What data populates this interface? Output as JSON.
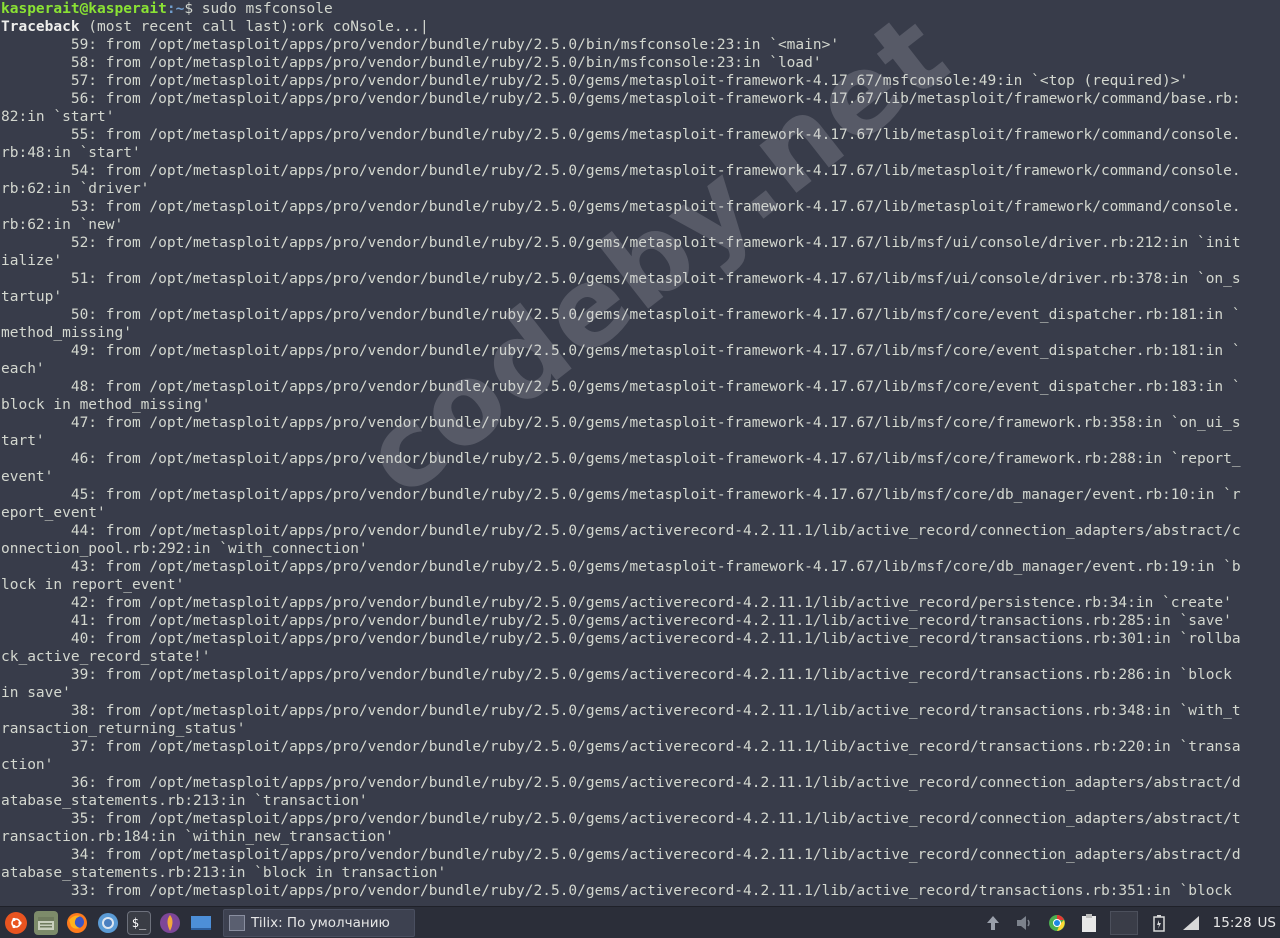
{
  "terminal": {
    "prompt_user": "kasperait@kasperait",
    "prompt_path": ":~",
    "prompt_cmd": "$ sudo msfconsole",
    "traceback_head": "Traceback",
    "traceback_rest": " (most recent call last):ork coNsole...|",
    "lines": [
      "        59: from /opt/metasploit/apps/pro/vendor/bundle/ruby/2.5.0/bin/msfconsole:23:in `<main>'",
      "        58: from /opt/metasploit/apps/pro/vendor/bundle/ruby/2.5.0/bin/msfconsole:23:in `load'",
      "        57: from /opt/metasploit/apps/pro/vendor/bundle/ruby/2.5.0/gems/metasploit-framework-4.17.67/msfconsole:49:in `<top (required)>'",
      "        56: from /opt/metasploit/apps/pro/vendor/bundle/ruby/2.5.0/gems/metasploit-framework-4.17.67/lib/metasploit/framework/command/base.rb:",
      "82:in `start'",
      "        55: from /opt/metasploit/apps/pro/vendor/bundle/ruby/2.5.0/gems/metasploit-framework-4.17.67/lib/metasploit/framework/command/console.",
      "rb:48:in `start'",
      "        54: from /opt/metasploit/apps/pro/vendor/bundle/ruby/2.5.0/gems/metasploit-framework-4.17.67/lib/metasploit/framework/command/console.",
      "rb:62:in `driver'",
      "        53: from /opt/metasploit/apps/pro/vendor/bundle/ruby/2.5.0/gems/metasploit-framework-4.17.67/lib/metasploit/framework/command/console.",
      "rb:62:in `new'",
      "        52: from /opt/metasploit/apps/pro/vendor/bundle/ruby/2.5.0/gems/metasploit-framework-4.17.67/lib/msf/ui/console/driver.rb:212:in `init",
      "ialize'",
      "        51: from /opt/metasploit/apps/pro/vendor/bundle/ruby/2.5.0/gems/metasploit-framework-4.17.67/lib/msf/ui/console/driver.rb:378:in `on_s",
      "tartup'",
      "        50: from /opt/metasploit/apps/pro/vendor/bundle/ruby/2.5.0/gems/metasploit-framework-4.17.67/lib/msf/core/event_dispatcher.rb:181:in `",
      "method_missing'",
      "        49: from /opt/metasploit/apps/pro/vendor/bundle/ruby/2.5.0/gems/metasploit-framework-4.17.67/lib/msf/core/event_dispatcher.rb:181:in `",
      "each'",
      "        48: from /opt/metasploit/apps/pro/vendor/bundle/ruby/2.5.0/gems/metasploit-framework-4.17.67/lib/msf/core/event_dispatcher.rb:183:in `",
      "block in method_missing'",
      "        47: from /opt/metasploit/apps/pro/vendor/bundle/ruby/2.5.0/gems/metasploit-framework-4.17.67/lib/msf/core/framework.rb:358:in `on_ui_s",
      "tart'",
      "        46: from /opt/metasploit/apps/pro/vendor/bundle/ruby/2.5.0/gems/metasploit-framework-4.17.67/lib/msf/core/framework.rb:288:in `report_",
      "event'",
      "        45: from /opt/metasploit/apps/pro/vendor/bundle/ruby/2.5.0/gems/metasploit-framework-4.17.67/lib/msf/core/db_manager/event.rb:10:in `r",
      "eport_event'",
      "        44: from /opt/metasploit/apps/pro/vendor/bundle/ruby/2.5.0/gems/activerecord-4.2.11.1/lib/active_record/connection_adapters/abstract/c",
      "onnection_pool.rb:292:in `with_connection'",
      "        43: from /opt/metasploit/apps/pro/vendor/bundle/ruby/2.5.0/gems/metasploit-framework-4.17.67/lib/msf/core/db_manager/event.rb:19:in `b",
      "lock in report_event'",
      "        42: from /opt/metasploit/apps/pro/vendor/bundle/ruby/2.5.0/gems/activerecord-4.2.11.1/lib/active_record/persistence.rb:34:in `create'",
      "        41: from /opt/metasploit/apps/pro/vendor/bundle/ruby/2.5.0/gems/activerecord-4.2.11.1/lib/active_record/transactions.rb:285:in `save'",
      "        40: from /opt/metasploit/apps/pro/vendor/bundle/ruby/2.5.0/gems/activerecord-4.2.11.1/lib/active_record/transactions.rb:301:in `rollba",
      "ck_active_record_state!'",
      "        39: from /opt/metasploit/apps/pro/vendor/bundle/ruby/2.5.0/gems/activerecord-4.2.11.1/lib/active_record/transactions.rb:286:in `block",
      "in save'",
      "        38: from /opt/metasploit/apps/pro/vendor/bundle/ruby/2.5.0/gems/activerecord-4.2.11.1/lib/active_record/transactions.rb:348:in `with_t",
      "ransaction_returning_status'",
      "        37: from /opt/metasploit/apps/pro/vendor/bundle/ruby/2.5.0/gems/activerecord-4.2.11.1/lib/active_record/transactions.rb:220:in `transa",
      "ction'",
      "        36: from /opt/metasploit/apps/pro/vendor/bundle/ruby/2.5.0/gems/activerecord-4.2.11.1/lib/active_record/connection_adapters/abstract/d",
      "atabase_statements.rb:213:in `transaction'",
      "        35: from /opt/metasploit/apps/pro/vendor/bundle/ruby/2.5.0/gems/activerecord-4.2.11.1/lib/active_record/connection_adapters/abstract/t",
      "ransaction.rb:184:in `within_new_transaction'",
      "        34: from /opt/metasploit/apps/pro/vendor/bundle/ruby/2.5.0/gems/activerecord-4.2.11.1/lib/active_record/connection_adapters/abstract/d",
      "atabase_statements.rb:213:in `block in transaction'",
      "        33: from /opt/metasploit/apps/pro/vendor/bundle/ruby/2.5.0/gems/activerecord-4.2.11.1/lib/active_record/transactions.rb:351:in `block"
    ]
  },
  "watermark": "codeby.net",
  "taskbar": {
    "task_label": "Tilix: По умолчанию",
    "clock": "15:28",
    "keyboard_layout": "US",
    "launchers": [
      "ubuntu-menu-icon",
      "file-manager-icon",
      "firefox-icon",
      "chromium-icon",
      "terminal-icon",
      "tor-browser-icon",
      "desktop-icon"
    ],
    "tray": [
      "upload-icon",
      "volume-icon",
      "chrome-tray-icon",
      "clipboard-icon",
      "workspace-icon",
      "battery-icon",
      "network-icon"
    ]
  }
}
